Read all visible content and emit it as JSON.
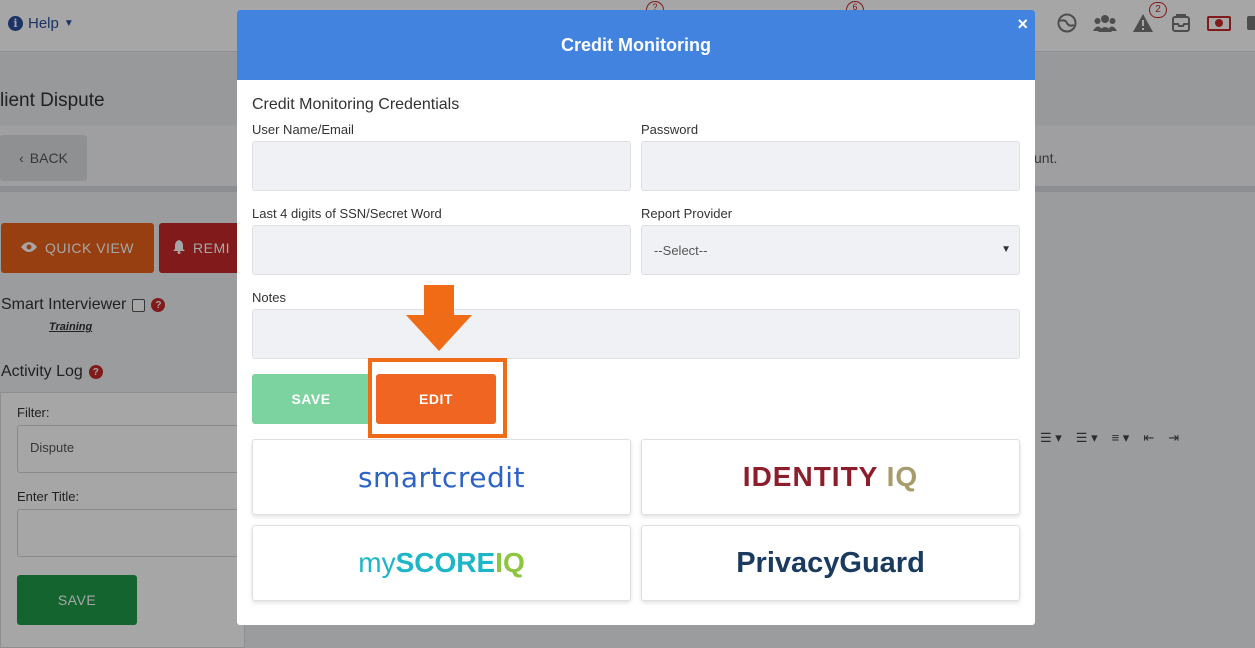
{
  "background": {
    "help_label": "Help",
    "top_badges": [
      "?",
      "6"
    ],
    "notification_count": "2",
    "page_title": "lient Dispute",
    "back_label": "BACK",
    "trailing_text": "unt.",
    "quick_view_label": "QUICK VIEW",
    "remind_label": "REMI",
    "smart_interviewer_label": "Smart Interviewer",
    "training_label": "Training",
    "activity_log_label": "Activity Log",
    "filter_label": "Filter:",
    "filter_value": "Dispute",
    "enter_title_label": "Enter Title:",
    "save_label": "SAVE"
  },
  "modal": {
    "title": "Credit Monitoring",
    "close_glyph": "×",
    "section_title": "Credit Monitoring Credentials",
    "fields": {
      "username_label": "User Name/Email",
      "password_label": "Password",
      "ssn_label": "Last 4 digits of SSN/Secret Word",
      "provider_label": "Report Provider",
      "provider_value": "--Select--",
      "notes_label": "Notes"
    },
    "save_label": "SAVE",
    "edit_label": "EDIT",
    "providers": {
      "smartcredit": "smartcredit",
      "identity_a": "IDENTITY",
      "identity_b": "IQ",
      "myscore_my": "my",
      "myscore_score": "SCORE",
      "myscore_iq": "IQ",
      "privacyguard": "PrivacyGuard"
    }
  },
  "colors": {
    "header_blue": "#4183df",
    "edit_orange": "#f06522",
    "save_green_light": "#7dd3a0",
    "highlight_orange": "#f06b16"
  }
}
